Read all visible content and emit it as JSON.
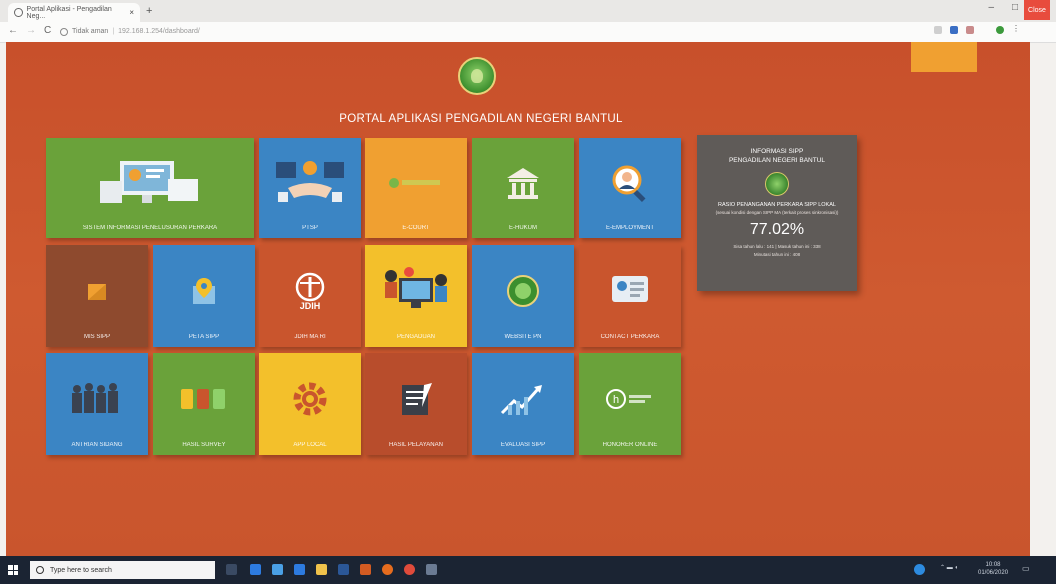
{
  "browser": {
    "tab_title": "Portal Aplikasi - Pengadilan Neg...",
    "tab_close": "×",
    "new_tab": "+",
    "window_min": "–",
    "window_max": "□",
    "window_close": "Close",
    "back": "←",
    "forward": "→",
    "reload": "C",
    "security_label": "Tidak aman",
    "url": "192.168.1.254/dashboard/"
  },
  "page": {
    "title": "PORTAL APLIKASI PENGADILAN NEGERI BANTUL",
    "tiles": [
      {
        "label": "SISTEM INFORMASI PENELUSURAN PERKARA",
        "color": "#6aa23a",
        "icon": "computer-devices-icon"
      },
      {
        "label": "PTSP",
        "color": "#3b85c4",
        "icon": "handshake-icon"
      },
      {
        "label": "E-COURT",
        "color": "#f0a031",
        "icon": "ecourt-logo-icon"
      },
      {
        "label": "E-HUKUM",
        "color": "#6aa23a",
        "icon": "building-icon"
      },
      {
        "label": "E-EMPLOYMENT",
        "color": "#3b85c4",
        "icon": "search-person-icon"
      },
      {
        "label": "MIS SIPP",
        "color": "#8e4a2e",
        "icon": "envelope-icon"
      },
      {
        "label": "PETA SIPP",
        "color": "#3b85c4",
        "icon": "map-pin-icon"
      },
      {
        "label": "JDIH MA RI",
        "color": "#c9552d",
        "icon": "jdih-scales-icon"
      },
      {
        "label": "PENGADUAN",
        "color": "#f3c02b",
        "icon": "people-computer-icon"
      },
      {
        "label": "WEBSITE PN",
        "color": "#3b85c4",
        "icon": "court-emblem-icon"
      },
      {
        "label": "CONTACT PERKARA",
        "color": "#c9552d",
        "icon": "contact-card-icon"
      },
      {
        "label": "ANTRIAN SIDANG",
        "color": "#3b85c4",
        "icon": "queue-people-icon"
      },
      {
        "label": "HASIL SURVEY",
        "color": "#6aa23a",
        "icon": "survey-icon"
      },
      {
        "label": "APP LOCAL",
        "color": "#f3c02b",
        "icon": "gear-icon"
      },
      {
        "label": "HASIL PELAYANAN",
        "color": "#b84d2c",
        "icon": "notepad-icon"
      },
      {
        "label": "EVALUASI SIPP",
        "color": "#3b85c4",
        "icon": "chart-growth-icon"
      },
      {
        "label": "HONORER ONLINE",
        "color": "#6aa23a",
        "icon": "h-circle-icon"
      }
    ]
  },
  "info_panel": {
    "heading_line1": "INFORMASI SIPP",
    "heading_line2": "PENGADILAN NEGERI BANTUL",
    "subtitle": "RASIO PENANGANAN PERKARA SIPP LOKAL",
    "note": "(sesuai kondisi dengan SIPP MA (terkait proses sinkronisasi))",
    "percentage": "77.02%",
    "stats_line1": "Sisa tahun lalu : 141 | Masuk tahun ini : 338",
    "stats_line2": "Minutasi tahun ini : 408"
  },
  "taskbar": {
    "search_placeholder": "Type here to search",
    "clock_time": "10:08",
    "clock_date": "01/06/2020"
  },
  "colors": {
    "background": "#c9552d",
    "corner_accent": "#f0a031",
    "info_panel": "#5f5b58"
  }
}
